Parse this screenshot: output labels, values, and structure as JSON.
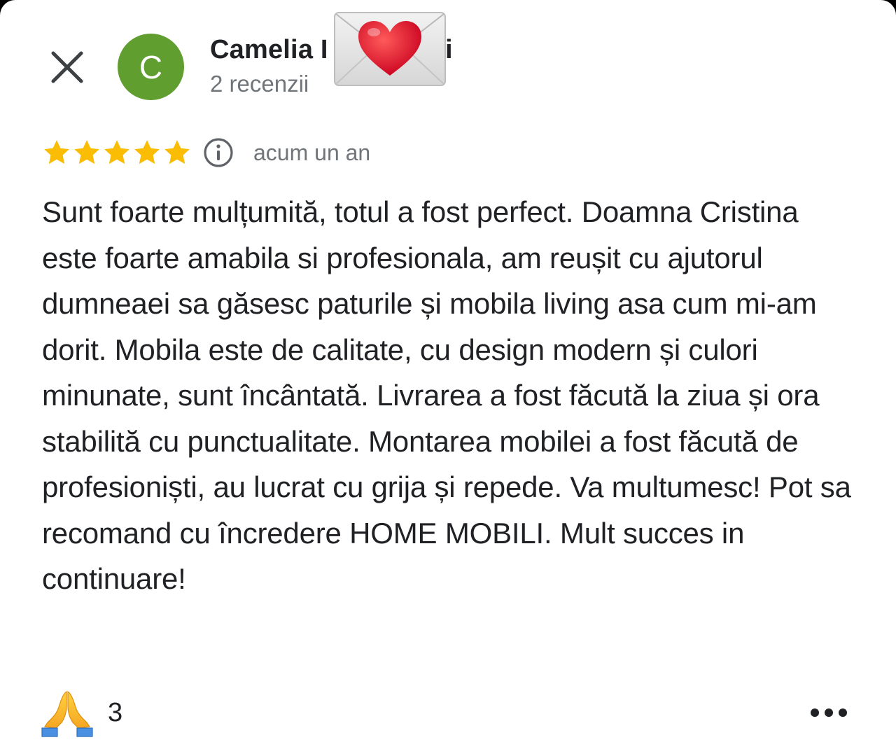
{
  "reviewer": {
    "avatar_initial": "C",
    "avatar_color": "#5f9e2f",
    "name": "Camelia I",
    "name_tail": "i",
    "meta": "2 recenzii"
  },
  "review": {
    "rating": 5,
    "max_rating": 5,
    "star_color": "#fbbc04",
    "time_ago": "acum un an",
    "text": "Sunt foarte mulțumită, totul a fost perfect. Doamna Cristina este foarte amabila si profesionala, am reușit cu ajutorul dumneaei sa găsesc paturile și mobila living asa cum mi-am dorit. Mobila este de calitate, cu design modern și culori minunate, sunt încântată. Livrarea a fost făcută la ziua și ora stabilită cu punctualitate. Montarea mobilei a fost făcută de profesioniști, au lucrat cu grija și repede. Va multumesc! Pot sa recomand cu încredere HOME MOBILI. Mult succes in continuare!"
  },
  "reactions": {
    "icon": "folded-hands-emoji",
    "count": "3"
  },
  "icons": {
    "close": "close-icon",
    "info": "info-icon",
    "more": "more-horizontal-icon",
    "redaction": "love-letter-emoji"
  }
}
